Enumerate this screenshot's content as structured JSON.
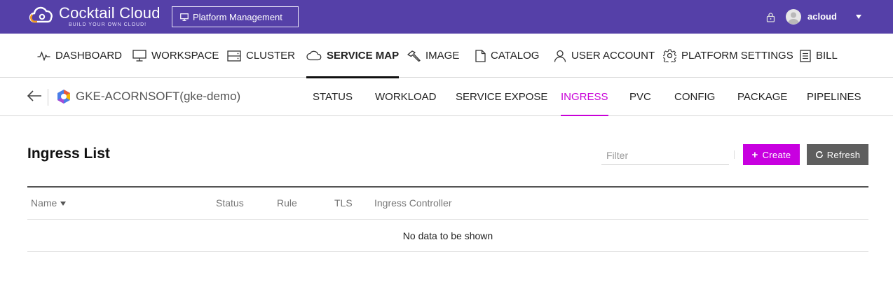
{
  "topbar": {
    "brand_title": "Cocktail Cloud",
    "brand_tagline": "BUILD YOUR OWN CLOUD!",
    "platform_button_label": "Platform Management",
    "username": "acloud",
    "colors": {
      "background": "#5540a8",
      "logo_orange": "#f39a1e"
    }
  },
  "mainnav": {
    "items": [
      {
        "label": "DASHBOARD",
        "icon": "pulse-icon"
      },
      {
        "label": "WORKSPACE",
        "icon": "monitor-icon"
      },
      {
        "label": "CLUSTER",
        "icon": "server-icon"
      },
      {
        "label": "SERVICE MAP",
        "icon": "cloud-icon",
        "active": true
      },
      {
        "label": "IMAGE",
        "icon": "hammer-icon"
      },
      {
        "label": "CATALOG",
        "icon": "document-icon"
      },
      {
        "label": "USER ACCOUNT",
        "icon": "user-icon"
      },
      {
        "label": "PLATFORM SETTINGS",
        "icon": "gear-icon"
      },
      {
        "label": "BILL",
        "icon": "bill-icon"
      }
    ]
  },
  "subheader": {
    "cluster_name": "GKE-ACORNSOFT(gke-demo)",
    "tabs": [
      {
        "label": "STATUS"
      },
      {
        "label": "WORKLOAD"
      },
      {
        "label": "SERVICE EXPOSE"
      },
      {
        "label": "INGRESS",
        "active": true
      },
      {
        "label": "PVC"
      },
      {
        "label": "CONFIG"
      },
      {
        "label": "PACKAGE"
      },
      {
        "label": "PIPELINES"
      }
    ],
    "active_color": "#c800d8"
  },
  "content": {
    "title": "Ingress List",
    "filter_placeholder": "Filter",
    "create_label": "Create",
    "refresh_label": "Refresh",
    "columns": [
      "Name",
      "Status",
      "Rule",
      "TLS",
      "Ingress Controller"
    ],
    "empty_message": "No data to be shown",
    "colors": {
      "create": "#c800e0",
      "refresh": "#5e5e5e"
    }
  }
}
